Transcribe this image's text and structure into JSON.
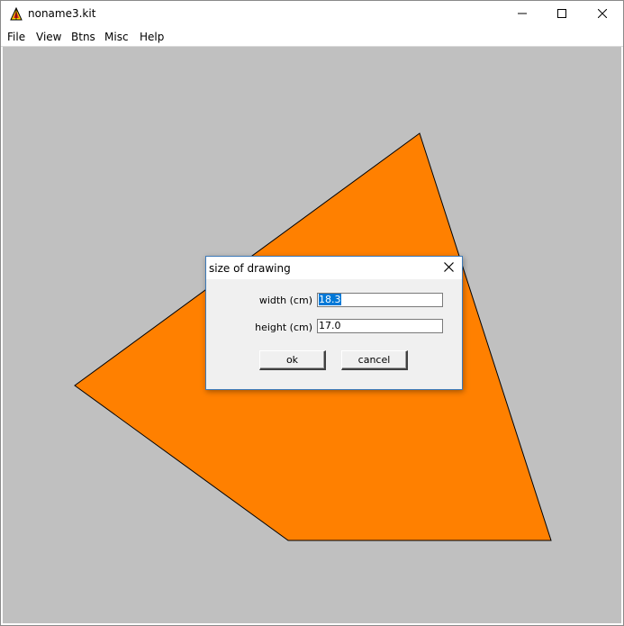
{
  "window": {
    "title": "noname3.kit",
    "icons": {
      "app": "kite-app-icon",
      "minimize": "minimize-icon",
      "maximize": "maximize-icon",
      "close": "close-icon"
    }
  },
  "menu": {
    "items": [
      "File",
      "View",
      "Btns",
      "Misc",
      "Help"
    ]
  },
  "canvas": {
    "background": "#c0c0c0",
    "shape": {
      "kind": "polygon",
      "fill": "#ff8000",
      "stroke": "#000000"
    }
  },
  "dialog": {
    "title": "size of drawing",
    "close_icon": "close-icon",
    "fields": {
      "width": {
        "label": "width (cm)",
        "value": "18.3",
        "selected": true
      },
      "height": {
        "label": "height (cm)",
        "value": "17.0",
        "selected": false
      }
    },
    "buttons": {
      "ok": "ok",
      "cancel": "cancel"
    }
  }
}
